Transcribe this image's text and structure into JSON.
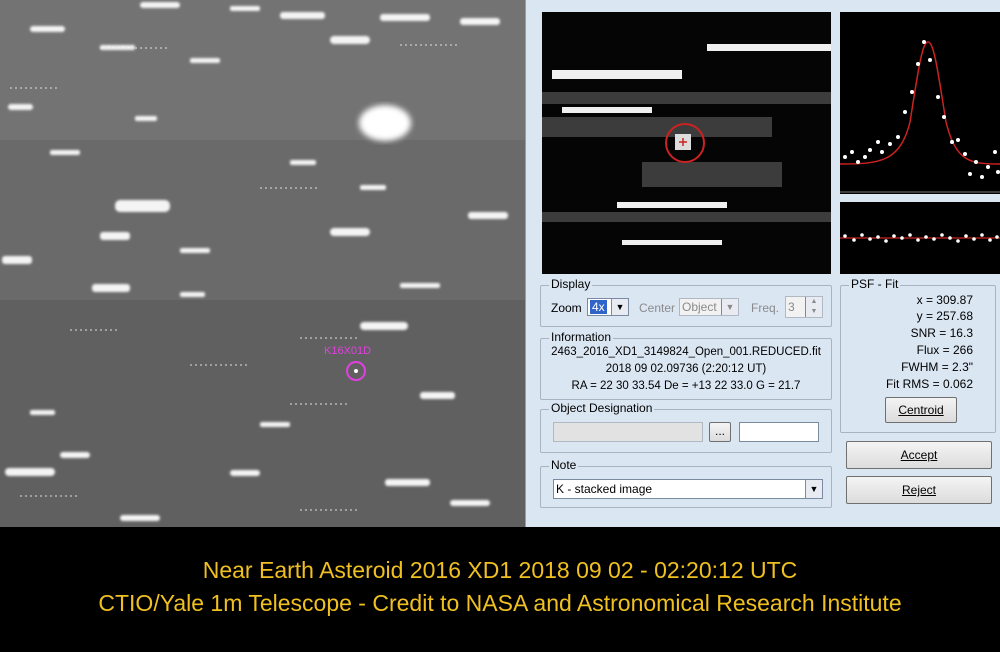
{
  "sky_image": {
    "target_label": "K16X01D"
  },
  "display": {
    "title": "Display",
    "zoom_label": "Zoom",
    "zoom_value": "4x",
    "center_label": "Center",
    "center_value": "Object",
    "freq_label": "Freq.",
    "freq_value": "3"
  },
  "information": {
    "title": "Information",
    "filename": "2463_2016_XD1_3149824_Open_001.REDUCED.fit",
    "datetime": "2018 09 02.09736 (2:20:12 UT)",
    "coords": "RA = 22 30 33.54   De = +13 22 33.0   G = 21.7"
  },
  "object_designation": {
    "title": "Object Designation",
    "browse_label": "...",
    "field_value": ""
  },
  "note": {
    "title": "Note",
    "value": "K - stacked image"
  },
  "psf_fit": {
    "title": "PSF - Fit",
    "x": "x = 309.87",
    "y": "y = 257.68",
    "snr": "SNR = 16.3",
    "flux": "Flux = 266",
    "fwhm": "FWHM = 2.3\"",
    "fit_rms": "Fit RMS = 0.062",
    "centroid_label": "Centroid"
  },
  "buttons": {
    "accept": "Accept",
    "reject": "Reject"
  },
  "caption": {
    "line1": "Near Earth Asteroid 2016 XD1 2018 09 02 - 02:20:12 UTC",
    "line2": "CTIO/Yale 1m Telescope - Credit to NASA and Astronomical Research Institute"
  },
  "colors": {
    "caption_text": "#f0c020",
    "target_marker": "#e040e0",
    "dialog_bg": "#dbe6f3",
    "fit_curve": "#cc2222"
  }
}
